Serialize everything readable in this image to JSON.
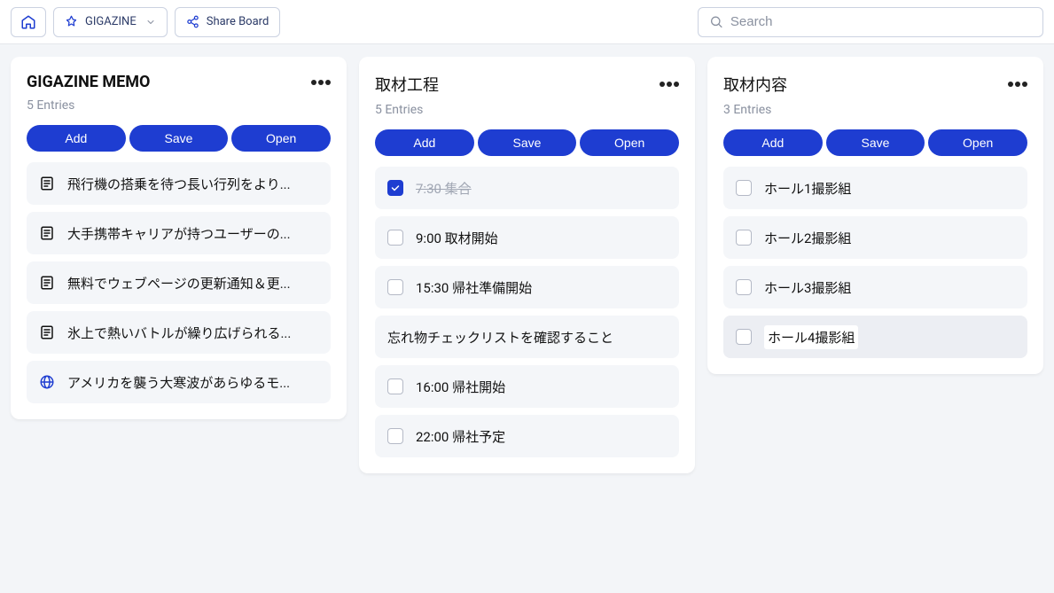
{
  "topbar": {
    "board_menu_label": "GIGAZINE",
    "share_label": "Share Board",
    "search_placeholder": "Search"
  },
  "buttons": {
    "add": "Add",
    "save": "Save",
    "open": "Open"
  },
  "columns": [
    {
      "title": "GIGAZINE MEMO",
      "title_bold": true,
      "sub": "5 Entries",
      "items": [
        {
          "type": "file",
          "text": "飛行機の搭乗を待つ長い行列をより..."
        },
        {
          "type": "file",
          "text": "大手携帯キャリアが持つユーザーの..."
        },
        {
          "type": "file",
          "text": "無料でウェブページの更新通知＆更..."
        },
        {
          "type": "file",
          "text": "氷上で熱いバトルが繰り広げられる..."
        },
        {
          "type": "web",
          "text": "アメリカを襲う大寒波があらゆるモ..."
        }
      ]
    },
    {
      "title": "取材工程",
      "title_bold": false,
      "sub": "5 Entries",
      "items": [
        {
          "type": "check",
          "checked": true,
          "text": "7:30 集合"
        },
        {
          "type": "check",
          "checked": false,
          "text": "9:00 取材開始"
        },
        {
          "type": "check",
          "checked": false,
          "text": "15:30 帰社準備開始"
        },
        {
          "type": "note",
          "text": "忘れ物チェックリストを確認すること"
        },
        {
          "type": "check",
          "checked": false,
          "text": "16:00 帰社開始"
        },
        {
          "type": "check",
          "checked": false,
          "text": "22:00 帰社予定"
        }
      ]
    },
    {
      "title": "取材内容",
      "title_bold": false,
      "sub": "3 Entries",
      "items": [
        {
          "type": "check",
          "checked": false,
          "text": "ホール1撮影組"
        },
        {
          "type": "check",
          "checked": false,
          "text": "ホール2撮影組"
        },
        {
          "type": "check",
          "checked": false,
          "text": "ホール3撮影組"
        },
        {
          "type": "check-editing",
          "checked": false,
          "text": "ホール4撮影組"
        }
      ]
    }
  ]
}
